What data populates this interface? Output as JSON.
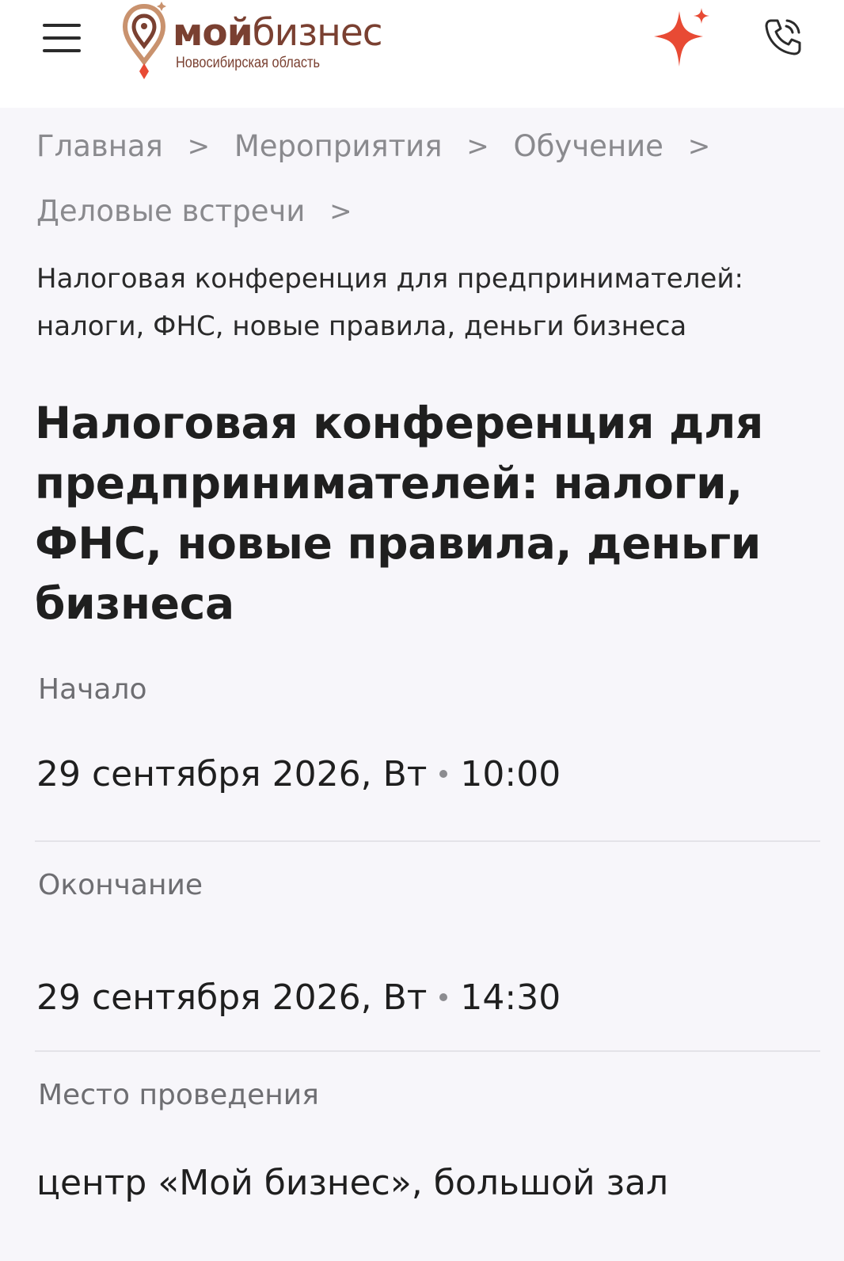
{
  "header": {
    "menu_icon": "hamburger-menu-icon",
    "logo": {
      "moy": "мой",
      "biznes": "бизнес",
      "region": "Новосибирская область",
      "brand_color": "#7a4031",
      "accent_color": "#e84a34"
    },
    "star_icon": "sparkle-star-icon",
    "phone_icon": "phone-call-icon"
  },
  "breadcrumb": {
    "items": [
      {
        "label": "Главная"
      },
      {
        "label": "Мероприятия"
      },
      {
        "label": "Обучение"
      },
      {
        "label": "Деловые встречи"
      }
    ],
    "separator": ">",
    "current": "Налоговая конференция для предпринимателей: налоги, ФНС, новые правила, деньги бизнеса"
  },
  "event": {
    "title": "Налоговая конференция для предпринимателей: налоги, ФНС, новые правила, деньги бизнеса",
    "start": {
      "label": "Начало",
      "date": "29 сентября 2026, Вт",
      "time": "10:00"
    },
    "end": {
      "label": "Окончание",
      "date": "29 сентября 2026, Вт",
      "time": "14:30"
    },
    "venue": {
      "label": "Место проведения",
      "value": "центр «Мой бизнес», большой зал"
    }
  }
}
